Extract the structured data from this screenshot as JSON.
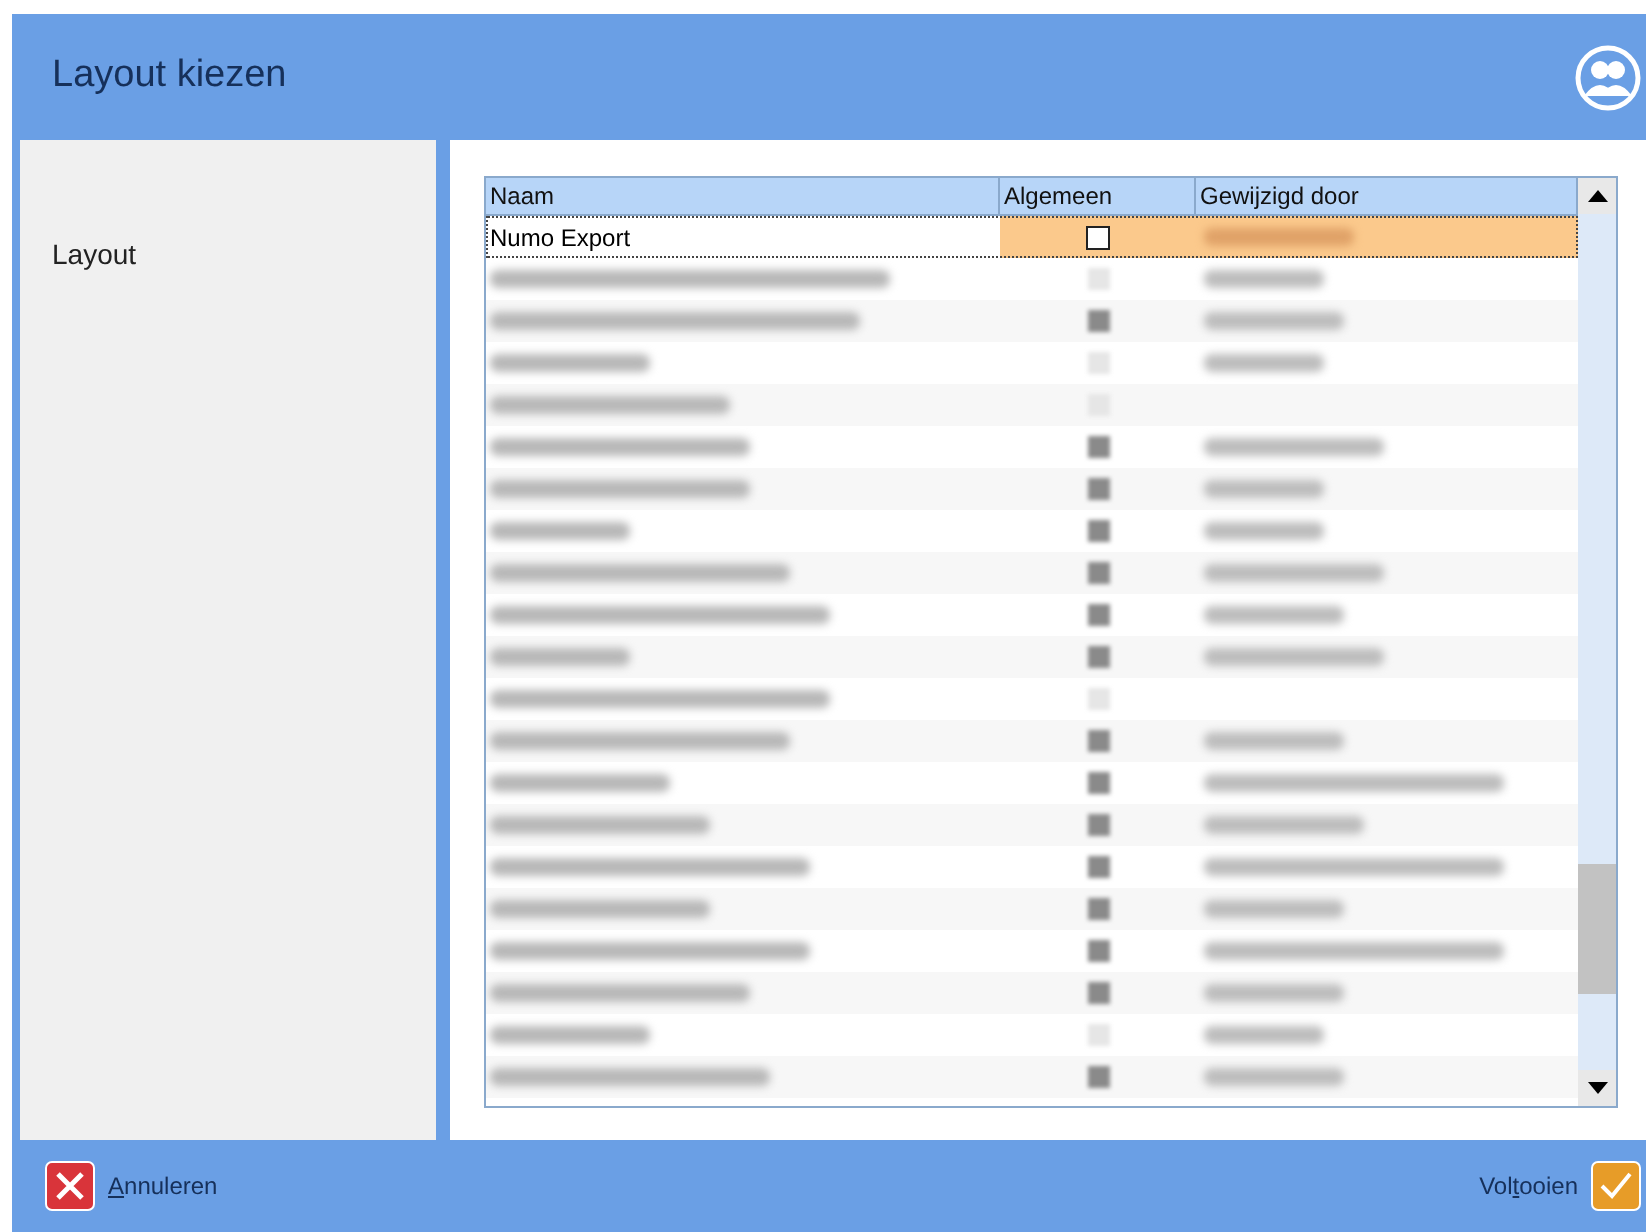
{
  "window": {
    "title": "Layout kiezen"
  },
  "sidebar": {
    "label": "Layout"
  },
  "table": {
    "columns": [
      "Naam",
      "Algemeen",
      "Gewijzigd door"
    ],
    "rows": [
      {
        "name": "Numo Export",
        "blurred": false,
        "checked": false,
        "modifier_blurred": true,
        "selected": true
      },
      {
        "blurred": true,
        "checked": false,
        "modifier_blurred": true,
        "selected": false
      },
      {
        "blurred": true,
        "checked": true,
        "modifier_blurred": true,
        "selected": false
      },
      {
        "blurred": true,
        "checked": false,
        "modifier_blurred": true,
        "selected": false
      },
      {
        "blurred": true,
        "checked": false,
        "modifier_blurred": false,
        "selected": false
      },
      {
        "blurred": true,
        "checked": true,
        "modifier_blurred": true,
        "selected": false
      },
      {
        "blurred": true,
        "checked": true,
        "modifier_blurred": true,
        "selected": false
      },
      {
        "blurred": true,
        "checked": true,
        "modifier_blurred": true,
        "selected": false
      },
      {
        "blurred": true,
        "checked": true,
        "modifier_blurred": true,
        "selected": false
      },
      {
        "blurred": true,
        "checked": true,
        "modifier_blurred": true,
        "selected": false
      },
      {
        "blurred": true,
        "checked": true,
        "modifier_blurred": true,
        "selected": false
      },
      {
        "blurred": true,
        "checked": false,
        "modifier_blurred": false,
        "selected": false
      },
      {
        "blurred": true,
        "checked": true,
        "modifier_blurred": true,
        "selected": false
      },
      {
        "blurred": true,
        "checked": true,
        "modifier_blurred": true,
        "selected": false
      },
      {
        "blurred": true,
        "checked": true,
        "modifier_blurred": true,
        "selected": false
      },
      {
        "blurred": true,
        "checked": true,
        "modifier_blurred": true,
        "selected": false
      },
      {
        "blurred": true,
        "checked": true,
        "modifier_blurred": true,
        "selected": false
      },
      {
        "blurred": true,
        "checked": true,
        "modifier_blurred": true,
        "selected": false
      },
      {
        "blurred": true,
        "checked": true,
        "modifier_blurred": true,
        "selected": false
      },
      {
        "blurred": true,
        "checked": false,
        "modifier_blurred": true,
        "selected": false
      },
      {
        "blurred": true,
        "checked": true,
        "modifier_blurred": true,
        "selected": false
      }
    ]
  },
  "buttons": [
    {
      "kind": "cancel",
      "key": "A",
      "after": "nnuleren"
    },
    {
      "kind": "finish",
      "before": "Vol",
      "key": "t",
      "after": "ooien"
    }
  ]
}
